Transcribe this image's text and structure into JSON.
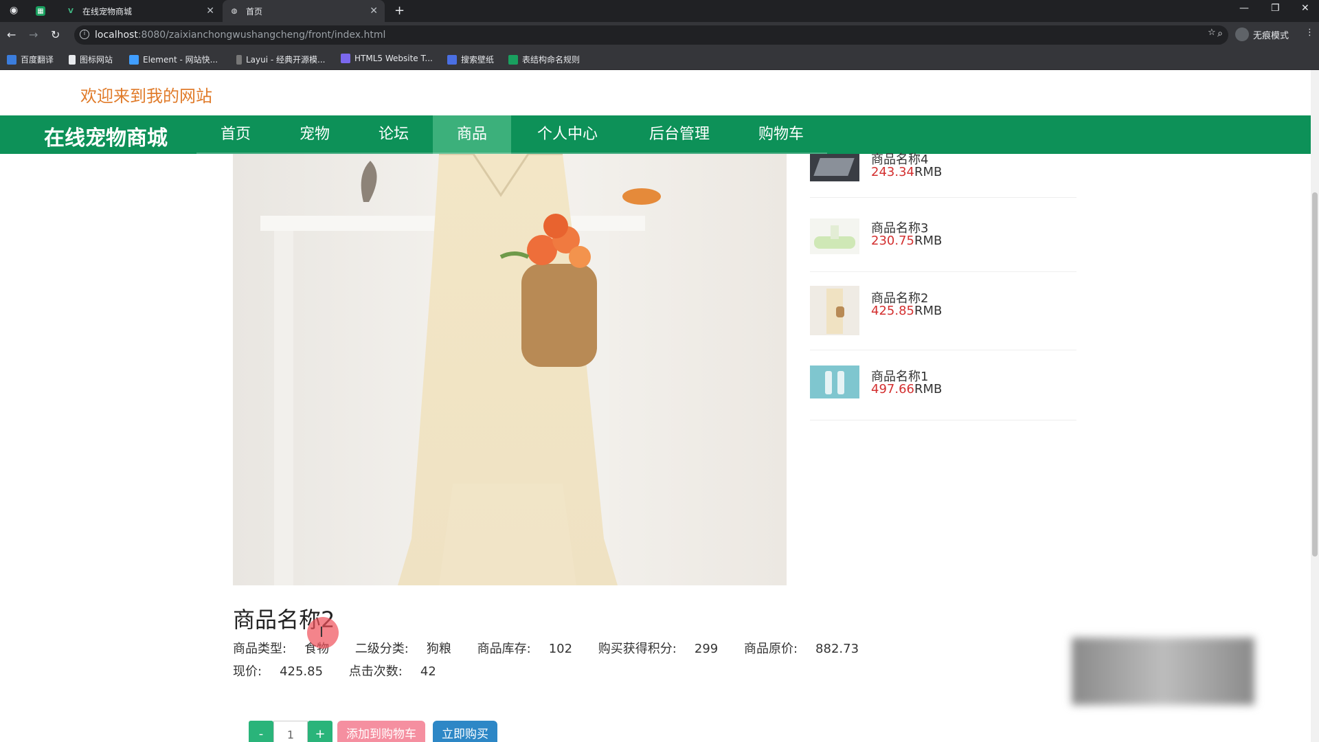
{
  "browser": {
    "tabs": [
      {
        "title": "在线宠物商城",
        "active": false
      },
      {
        "title": "首页",
        "active": true
      }
    ],
    "url_host": "localhost",
    "url_path": ":8080/zaixianchongwushangcheng/front/index.html",
    "profile_label": "无痕模式",
    "bookmarks": [
      "百度翻译",
      "图标网站",
      "Element - 网站快...",
      "Layui - 经典开源模...",
      "HTML5 Website T...",
      "搜索壁纸",
      "表结构命名规则"
    ]
  },
  "site": {
    "welcome": "欢迎来到我的网站",
    "brand": "在线宠物商城",
    "nav": [
      "首页",
      "宠物",
      "论坛",
      "商品",
      "个人中心",
      "后台管理",
      "购物车"
    ],
    "active_nav": "商品"
  },
  "product": {
    "name": "商品名称2",
    "type_label": "商品类型:",
    "type_value": "食物",
    "sub_label": "二级分类:",
    "sub_value": "狗粮",
    "stock_label": "商品库存:",
    "stock_value": "102",
    "points_label": "购买获得积分:",
    "points_value": "299",
    "orig_label": "商品原价:",
    "orig_value": "882.73",
    "price_label": "现价:",
    "price_value": "425.85",
    "clicks_label": "点击次数:",
    "clicks_value": "42",
    "qty_minus": "-",
    "qty_value": "1",
    "qty_plus": "+",
    "add_cart": "添加到购物车",
    "buy_now": "立即购买"
  },
  "sidebar": {
    "items": [
      {
        "name": "商品名称4",
        "price": "243.34",
        "unit": "RMB"
      },
      {
        "name": "商品名称3",
        "price": "230.75",
        "unit": "RMB"
      },
      {
        "name": "商品名称2",
        "price": "425.85",
        "unit": "RMB"
      },
      {
        "name": "商品名称1",
        "price": "497.66",
        "unit": "RMB"
      }
    ]
  }
}
